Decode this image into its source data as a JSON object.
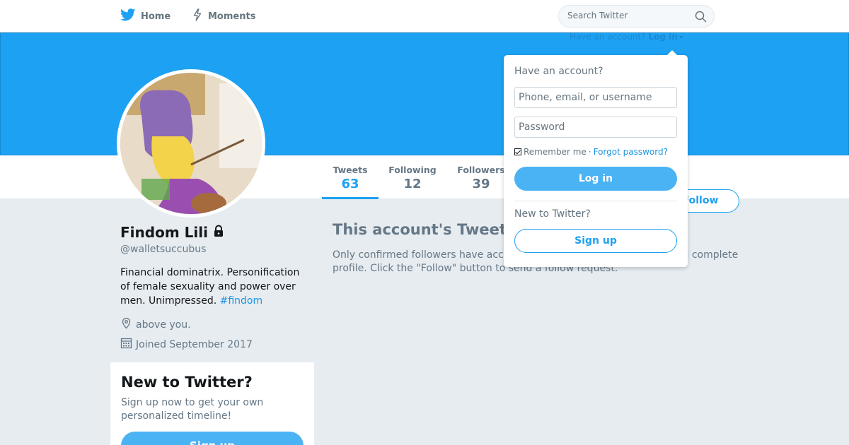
{
  "nav": {
    "home_label": "Home",
    "moments_label": "Moments",
    "search_placeholder": "Search Twitter"
  },
  "header": {
    "have_account": "Have an account?",
    "login_link": "Log in"
  },
  "profile": {
    "name": "Findom Lili",
    "handle": "@walletsuccubus",
    "bio_text": "Financial dominatrix. Personification of female sexuality and power over men. Unimpressed.",
    "bio_hashtag": "#findom",
    "location": "above you.",
    "joined": "Joined September 2017"
  },
  "stats": {
    "tweets_label": "Tweets",
    "tweets_value": "63",
    "following_label": "Following",
    "following_value": "12",
    "followers_label": "Followers",
    "followers_value": "39"
  },
  "follow_button": "Follow",
  "protected": {
    "title": "This account's Tweets are protected.",
    "desc": "Only confirmed followers have access to @walletsuccubus's Tweets and complete profile. Click the \"Follow\" button to send a follow request."
  },
  "new_card": {
    "title": "New to Twitter?",
    "desc": "Sign up now to get your own personalized timeline!",
    "button": "Sign up"
  },
  "login_dropdown": {
    "heading": "Have an account?",
    "username_placeholder": "Phone, email, or username",
    "password_placeholder": "Password",
    "remember_label": "Remember me",
    "separator": "·",
    "forgot_label": "Forgot password?",
    "login_button": "Log in",
    "new_heading": "New to Twitter?",
    "signup_button": "Sign up"
  },
  "colors": {
    "accent": "#1da1f2",
    "button_fill": "#4ab3f4",
    "background": "#e6ecf0"
  }
}
